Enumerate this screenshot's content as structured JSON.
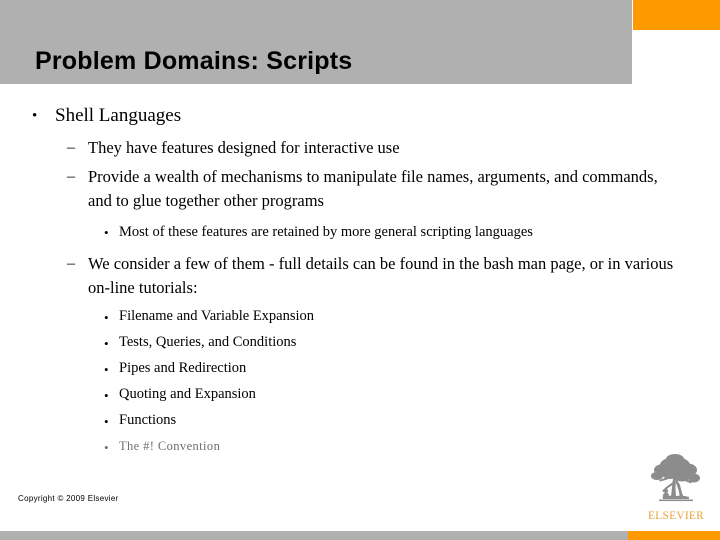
{
  "slide": {
    "title": "Problem Domains: Scripts",
    "colors": {
      "header_gray": "#B0B0B0",
      "accent_orange": "#FF9900",
      "text_black": "#000000",
      "logo_gold": "#E8A33D",
      "faded_text": "#6F6F6F"
    }
  },
  "bullets": {
    "level1": "Shell Languages",
    "level2_a": "They have features designed for interactive use",
    "level2_b": "Provide a wealth of mechanisms to manipulate file names, arguments, and commands, and to glue together other programs",
    "level3_a": "Most of these features are retained by more general scripting languages",
    "level2_c": "We consider a few of them - full details can be found in the bash man page, or in various on-line tutorials:",
    "marker_disc": "•",
    "marker_dash": "–"
  },
  "topics": [
    "Filename and Variable Expansion",
    "Tests, Queries, and Conditions",
    "Pipes and Redirection",
    "Quoting and Expansion",
    "Functions",
    "The #! Convention"
  ],
  "footer": {
    "copyright": "Copyright © 2009 Elsevier",
    "logo_wordmark": "ELSEVIER"
  }
}
